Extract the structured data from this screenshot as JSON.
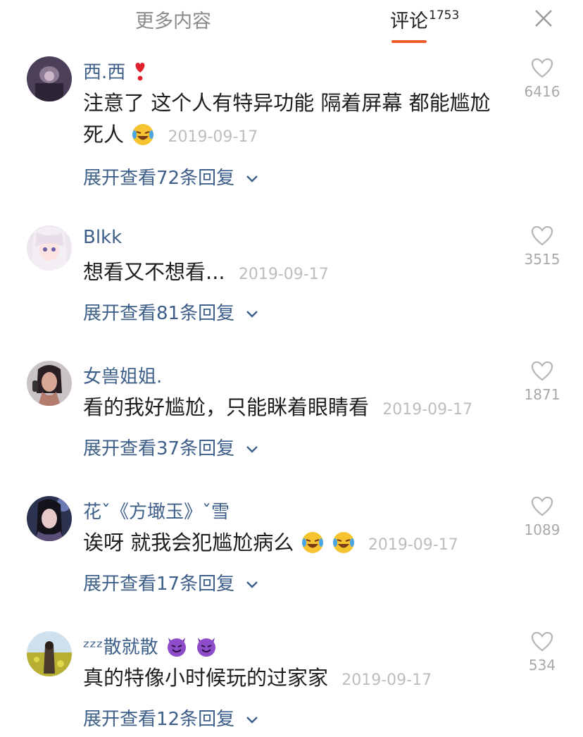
{
  "tabs": {
    "more_label": "更多内容",
    "comments_label": "评论",
    "comments_count": "1753",
    "active_color": "#f25a29"
  },
  "colors": {
    "username": "#3d5f8a",
    "text": "#1e1e1e",
    "date": "#bdbdbd",
    "like": "#a8a8a8"
  },
  "comments": [
    {
      "username": "西.西",
      "text": "注意了  这个人有特异功能  隔着屏幕  都能尴尬死人",
      "date": "2019-09-17",
      "replies": "展开查看72条回复",
      "likes": "6416",
      "username_icons": [
        "heart-exclamation-icon"
      ],
      "text_icons": [
        "laughing-crying-emoji"
      ]
    },
    {
      "username": "Blkk",
      "text": "想看又不想看...",
      "date": "2019-09-17",
      "replies": "展开查看81条回复",
      "likes": "3515"
    },
    {
      "username": "女兽姐姐.",
      "text": "看的我好尴尬，只能眯着眼睛看",
      "date": "2019-09-17",
      "replies": "展开查看37条回复",
      "likes": "1871"
    },
    {
      "username": "花ˇ《方𡑒玉》ˇ雪",
      "text": "诶呀 就我会犯尴尬病么",
      "date": "2019-09-17",
      "replies": "展开查看17条回复",
      "likes": "1089",
      "text_icons": [
        "laughing-crying-emoji",
        "laughing-crying-emoji"
      ]
    },
    {
      "username": "ᶻᶻᶻ散就散",
      "text": "真的特像小时候玩的过家家",
      "date": "2019-09-17",
      "replies": "展开查看12条回复",
      "likes": "534",
      "username_icons": [
        "devil-emoji",
        "devil-emoji"
      ]
    }
  ]
}
